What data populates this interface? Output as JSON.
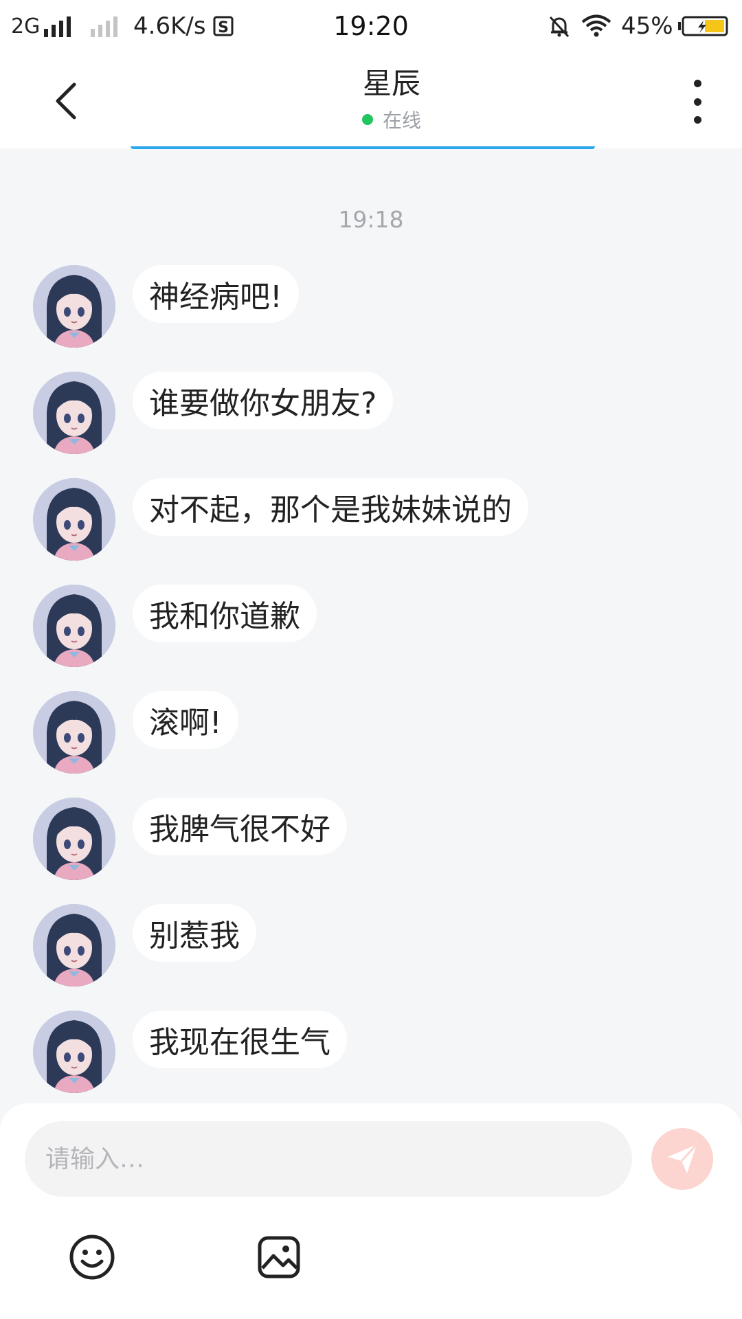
{
  "status_bar": {
    "network": "2G",
    "speed": "4.6K/s",
    "time": "19:20",
    "battery_pct": "45%"
  },
  "header": {
    "contact_name": "星辰",
    "status": "在线",
    "accent_color": "#2aa8ec"
  },
  "chat": {
    "timestamp": "19:18",
    "messages": [
      {
        "text": "神经病吧!"
      },
      {
        "text": "谁要做你女朋友?"
      },
      {
        "text": "对不起，那个是我妹妹说的"
      },
      {
        "text": "我和你道歉"
      },
      {
        "text": "滚啊!"
      },
      {
        "text": "我脾气很不好"
      },
      {
        "text": "别惹我"
      },
      {
        "text": "我现在很生气"
      }
    ]
  },
  "composer": {
    "placeholder": "请输入…",
    "value": ""
  },
  "icons": {
    "back": "chevron-left-icon",
    "more": "more-vertical-icon",
    "send": "send-icon",
    "emoji": "smile-icon",
    "image": "image-icon",
    "mute": "bell-off-icon",
    "wifi": "wifi-icon",
    "battery": "battery-charging-icon"
  }
}
